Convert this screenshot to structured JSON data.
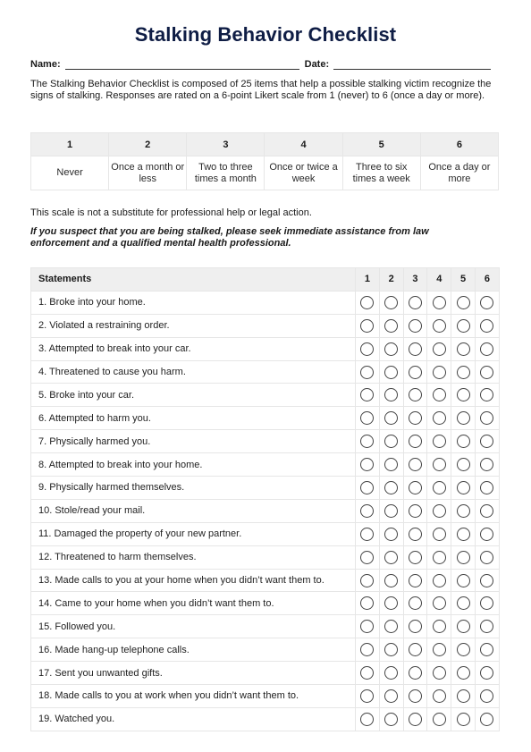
{
  "title": "Stalking Behavior Checklist",
  "form": {
    "name_label": "Name:",
    "name_value": "",
    "date_label": "Date:",
    "date_value": ""
  },
  "intro": "The Stalking Behavior Checklist is composed of 25 items that help a possible stalking victim recognize the signs of stalking. Responses are rated on a 6-point Likert scale from 1 (never) to 6 (once a day or more).",
  "scale": [
    {
      "value": "1",
      "label": "Never"
    },
    {
      "value": "2",
      "label": "Once a month or less"
    },
    {
      "value": "3",
      "label": "Two to three times a month"
    },
    {
      "value": "4",
      "label": "Once or twice a week"
    },
    {
      "value": "5",
      "label": "Three to six times a week"
    },
    {
      "value": "6",
      "label": "Once a day or more"
    }
  ],
  "note": "This scale is not a substitute for professional help or legal action.",
  "warning": "If you suspect that you are being stalked, please seek immediate assistance from law enforcement and a qualified mental health professional.",
  "table": {
    "statements_header": "Statements",
    "rating_headers": [
      "1",
      "2",
      "3",
      "4",
      "5",
      "6"
    ],
    "items": [
      "1. Broke into your home.",
      "2. Violated a restraining order.",
      "3. Attempted to break into your car.",
      "4. Threatened to cause you harm.",
      "5. Broke into your car.",
      "6. Attempted to harm you.",
      "7. Physically harmed you.",
      "8. Attempted to break into your home.",
      "9. Physically harmed themselves.",
      "10. Stole/read your mail.",
      "11. Damaged the property of your new partner.",
      "12. Threatened to harm themselves.",
      "13. Made calls to you at your home when you didn’t want them to.",
      "14. Came to your home when you didn’t want them to.",
      "15. Followed you.",
      "16. Made hang-up telephone calls.",
      "17. Sent you unwanted gifts.",
      "18. Made calls to you at work when you didn’t want them to.",
      "19. Watched you."
    ]
  },
  "colors": {
    "title": "#0f1d45",
    "header_bg": "#efefef",
    "border": "#e6e6e6"
  }
}
